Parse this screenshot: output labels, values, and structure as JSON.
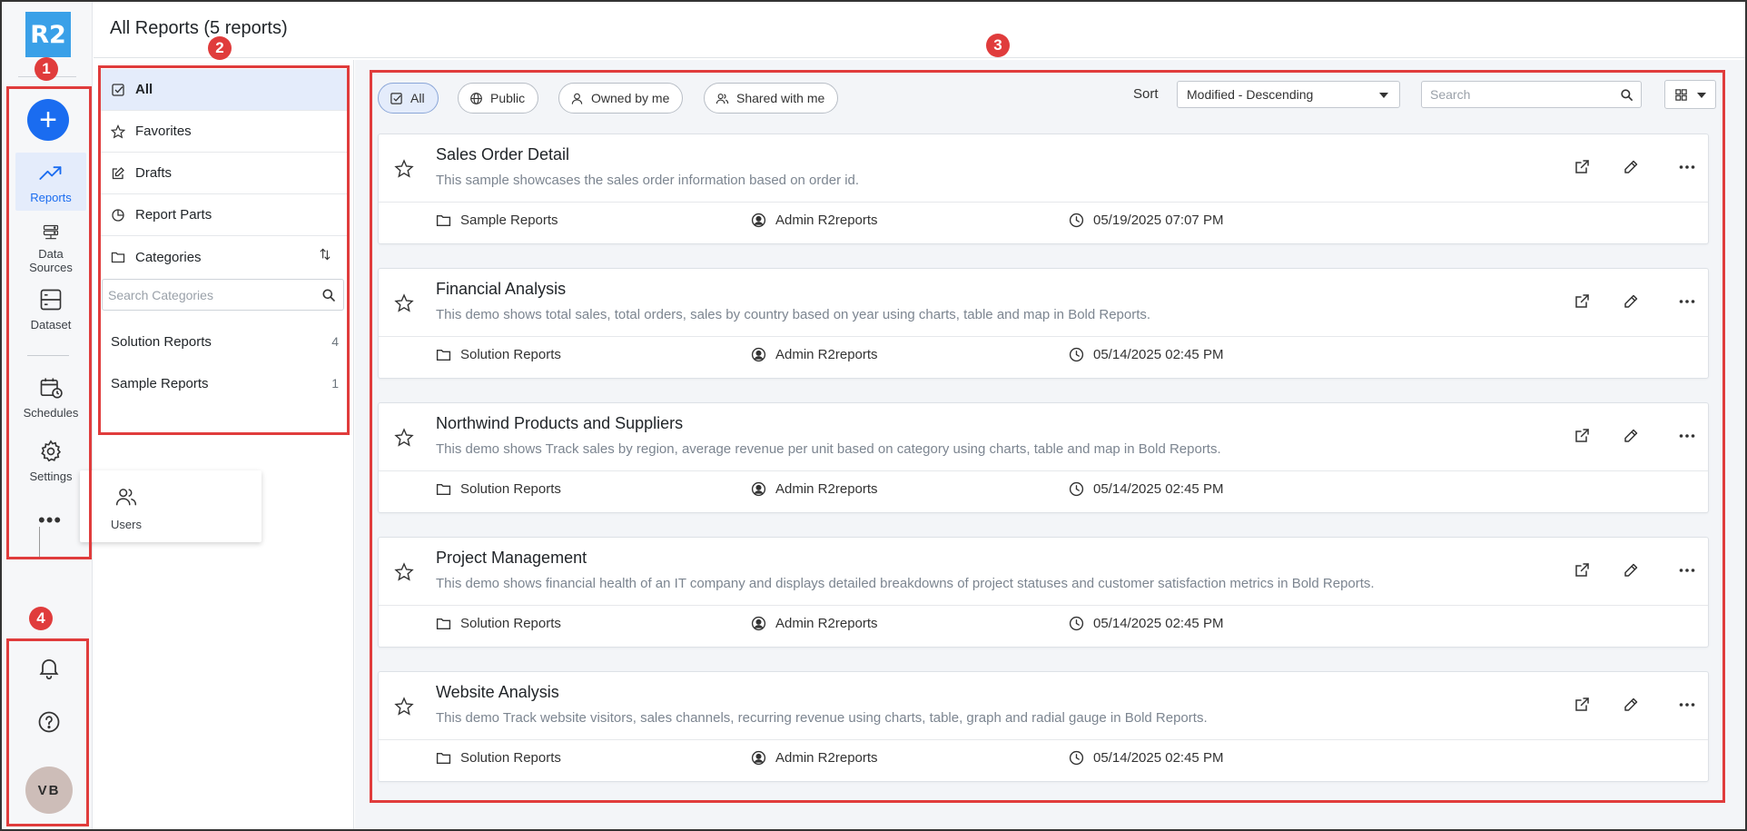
{
  "app": {
    "logo_text": "R2"
  },
  "nav": {
    "items": [
      {
        "label": "Reports",
        "icon": "trending-up-icon"
      },
      {
        "label": "Data Sources",
        "icon": "server-icon"
      },
      {
        "label": "Dataset",
        "icon": "dataset-icon"
      },
      {
        "label": "Schedules",
        "icon": "calendar-clock-icon"
      },
      {
        "label": "Settings",
        "icon": "gear-icon"
      }
    ],
    "more_label": "•••",
    "popup_users_label": "Users",
    "avatar_initials": "VB"
  },
  "header": {
    "title": "All Reports (5 reports)"
  },
  "categories": {
    "menu": [
      {
        "label": "All",
        "icon": "checkbox-icon"
      },
      {
        "label": "Favorites",
        "icon": "star-icon"
      },
      {
        "label": "Drafts",
        "icon": "edit-icon"
      },
      {
        "label": "Report Parts",
        "icon": "pie-icon"
      },
      {
        "label": "Categories",
        "icon": "folder-icon"
      }
    ],
    "search_placeholder": "Search Categories",
    "list": [
      {
        "name": "Solution Reports",
        "count": "4"
      },
      {
        "name": "Sample Reports",
        "count": "1"
      }
    ]
  },
  "filters": {
    "chips": [
      {
        "label": "All",
        "icon": "checkbox-icon"
      },
      {
        "label": "Public",
        "icon": "globe-icon"
      },
      {
        "label": "Owned by me",
        "icon": "user-icon"
      },
      {
        "label": "Shared with me",
        "icon": "users-icon"
      }
    ],
    "sort_label": "Sort",
    "sort_value": "Modified - Descending",
    "search_placeholder": "Search"
  },
  "reports": [
    {
      "title": "Sales Order Detail",
      "description": "This sample showcases the sales order information based on order id.",
      "category": "Sample Reports",
      "owner": "Admin R2reports",
      "modified": "05/19/2025 07:07 PM"
    },
    {
      "title": "Financial Analysis",
      "description": "This demo shows total sales, total orders, sales by country based on year using charts, table and map in Bold Reports.",
      "category": "Solution Reports",
      "owner": "Admin R2reports",
      "modified": "05/14/2025 02:45 PM"
    },
    {
      "title": "Northwind Products and Suppliers",
      "description": "This demo shows Track sales by region, average revenue per unit based on category using charts, table and map in Bold Reports.",
      "category": "Solution Reports",
      "owner": "Admin R2reports",
      "modified": "05/14/2025 02:45 PM"
    },
    {
      "title": "Project Management",
      "description": "This demo shows financial health of an IT company and displays detailed breakdowns of project statuses and customer satisfaction metrics in Bold Reports.",
      "category": "Solution Reports",
      "owner": "Admin R2reports",
      "modified": "05/14/2025 02:45 PM"
    },
    {
      "title": "Website Analysis",
      "description": "This demo Track website visitors, sales channels, recurring revenue using charts, table, graph and radial gauge in Bold Reports.",
      "category": "Solution Reports",
      "owner": "Admin R2reports",
      "modified": "05/14/2025 02:45 PM"
    }
  ],
  "annotations": [
    "1",
    "2",
    "3",
    "4"
  ],
  "colors": {
    "accent": "#1a6cf0",
    "annotation": "#e03c3c",
    "logo": "#3aa0e8"
  }
}
